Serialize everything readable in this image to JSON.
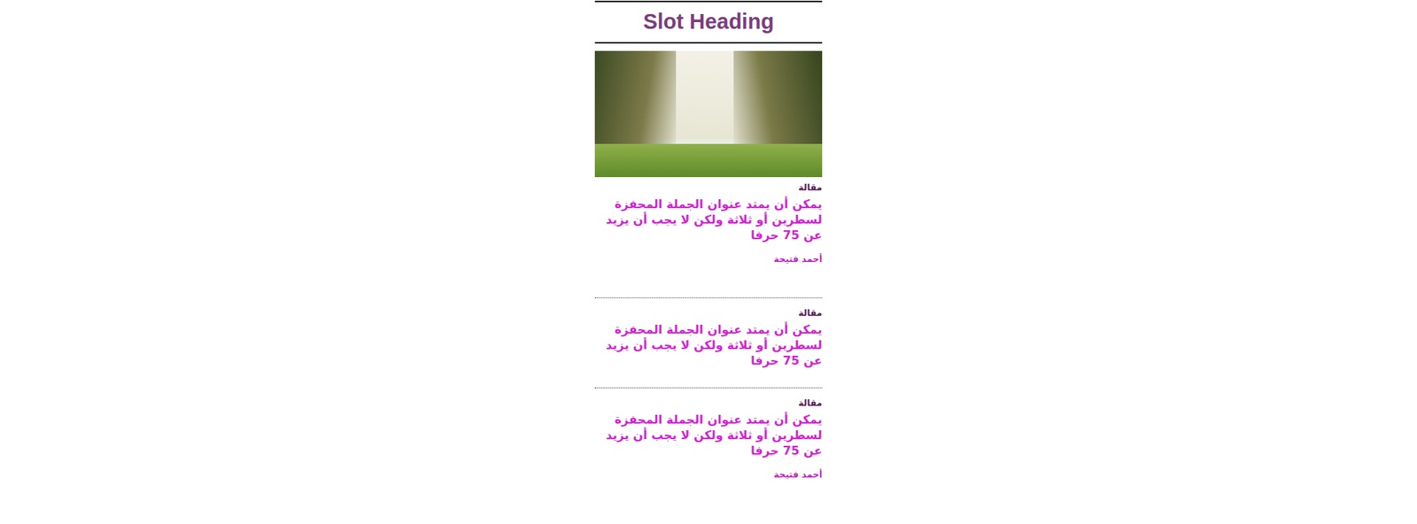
{
  "slot": {
    "heading": "Slot Heading"
  },
  "feature_image": {
    "kind": "photo"
  },
  "articles": [
    {
      "label": "مقالة",
      "title": "يمكن أن يمتد عنوان الجملة المحفزة لسطرين أو ثلاثة ولكن لا يجب أن يزيد عن 75 حرفا",
      "author": "أحمد فتيحة"
    },
    {
      "label": "مقالة",
      "title": "يمكن أن يمتد عنوان الجملة المحفزة لسطرين أو ثلاثة ولكن لا يجب أن يزيد عن 75 حرفا"
    },
    {
      "label": "مقالة",
      "title": "يمكن أن يمتد عنوان الجملة المحفزة لسطرين أو ثلاثة ولكن لا يجب أن يزيد عن 75 حرفا",
      "author": "أحمد فتيحة"
    }
  ]
}
